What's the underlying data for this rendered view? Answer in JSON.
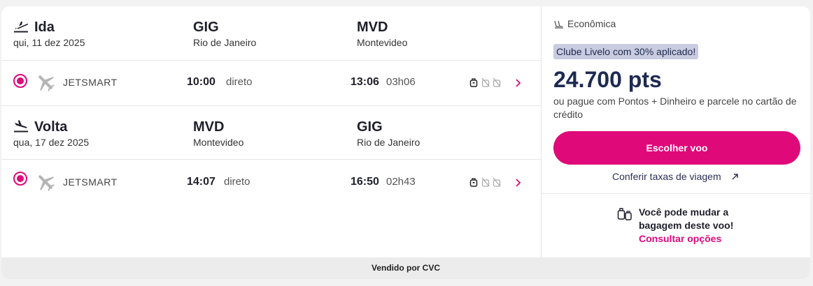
{
  "outbound": {
    "title": "Ida",
    "date": "qui, 11 dez 2025",
    "origin_code": "GIG",
    "origin_city": "Rio de Janeiro",
    "dest_code": "MVD",
    "dest_city": "Montevideo",
    "flight": {
      "airline": "JETSMART",
      "depart_time": "10:00",
      "stops": "direto",
      "arrive_time": "13:06",
      "duration": "03h06"
    }
  },
  "inbound": {
    "title": "Volta",
    "date": "qua, 17 dez 2025",
    "origin_code": "MVD",
    "origin_city": "Montevideo",
    "dest_code": "GIG",
    "dest_city": "Rio de Janeiro",
    "flight": {
      "airline": "JETSMART",
      "depart_time": "14:07",
      "stops": "direto",
      "arrive_time": "16:50",
      "duration": "02h43"
    }
  },
  "summary": {
    "cabin": "Econômica",
    "promo": "Clube Livelo com 30% aplicado!",
    "points": "24.700 pts",
    "pay_text": "ou pague com Pontos + Dinheiro e parcele no cartão de crédito",
    "cta_label": "Escolher voo",
    "taxes_link": "Conferir taxas de viagem",
    "baggage_text": "Você pode mudar a bagagem deste voo!",
    "baggage_link": "Consultar opções"
  },
  "footer": {
    "sold_by": "Vendido por CVC"
  },
  "icons": {
    "departure": "airplane-takeoff-icon",
    "arrival": "airplane-landing-icon",
    "airline_logo": "airplane-icon",
    "bag": "carry-on-bag-icon",
    "bag_crossed": "bag-not-included-icon",
    "chevron": "chevron-right-icon",
    "cabin": "seat-icon",
    "external": "arrow-up-right-icon",
    "baggage_change": "luggage-swap-icon"
  },
  "colors": {
    "accent": "#e0097a",
    "navy": "#1d2a52",
    "promo_bg": "#c9cbe0"
  }
}
